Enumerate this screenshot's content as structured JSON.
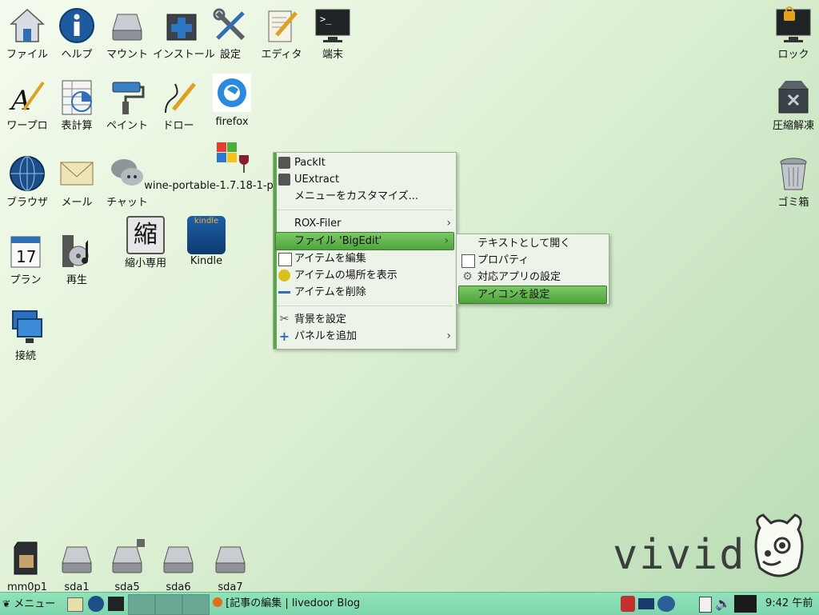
{
  "desktop_icons": {
    "files": "ファイル",
    "help": "ヘルプ",
    "mount": "マウント",
    "install": "インストール",
    "settings": "設定",
    "editor": "エディタ",
    "terminal": "端末",
    "lock": "ロック",
    "wordpro": "ワープロ",
    "spreadsheet": "表計算",
    "paint": "ペイント",
    "draw": "ドロー",
    "firefox": "firefox",
    "unzip": "圧縮解凍",
    "browser": "ブラウザ",
    "mail": "メール",
    "chat": "チャット",
    "wine": "wine-portable-1.7.18-1-p",
    "trash": "ゴミ箱",
    "shrink": "縮小専用",
    "kindle": "Kindle",
    "planner": "プラン",
    "planner_day": "17",
    "play": "再生",
    "connect": "接続",
    "drives": [
      "mm0p1",
      "sda1",
      "sda5",
      "sda6",
      "sda7"
    ],
    "shrink_glyph": "縮",
    "kindle_badge": "kindle"
  },
  "brand": "vivid",
  "context_menu": {
    "items": [
      {
        "label": "PackIt",
        "icon": "packit-icon"
      },
      {
        "label": "UExtract",
        "icon": "uextract-icon"
      },
      {
        "label": "メニューをカスタマイズ...",
        "icon": ""
      },
      {
        "label": "ROX-Filer",
        "icon": ""
      },
      {
        "label": "ファイル 'BigEdit'",
        "icon": ""
      },
      {
        "label": "アイテムを編集",
        "icon": "edit-item-icon"
      },
      {
        "label": "アイテムの場所を表示",
        "icon": "show-location-icon"
      },
      {
        "label": "アイテムを削除",
        "icon": "remove-icon"
      },
      {
        "label": "背景を設定",
        "icon": "background-icon"
      },
      {
        "label": "パネルを追加",
        "icon": "add-panel-icon"
      }
    ]
  },
  "sub_menu": {
    "items": [
      {
        "label": "テキストとして開く"
      },
      {
        "label": "プロパティ"
      },
      {
        "label": "対応アプリの設定"
      },
      {
        "label": "アイコンを設定"
      }
    ]
  },
  "taskbar": {
    "menu_label": "メニュー",
    "window_title": "[記事の編集 | livedoor Blog",
    "clock": "9:42 午前"
  },
  "colors": {
    "accent": "#5aa64a",
    "taskbar": "#8fe3b8",
    "menu_bg": "#eef3ea"
  }
}
